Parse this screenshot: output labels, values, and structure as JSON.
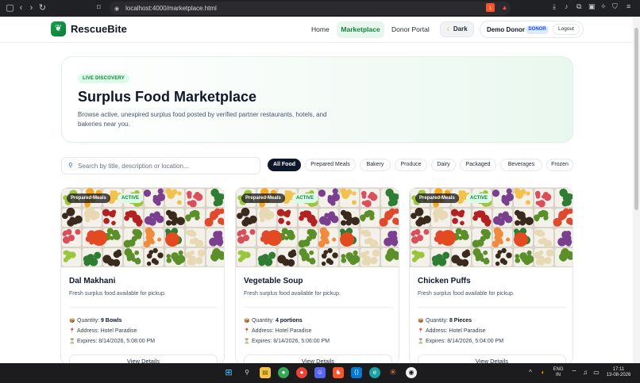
{
  "browser": {
    "url": "localhost:4000/marketplace.html",
    "brave_badge": "1"
  },
  "header": {
    "brand": "RescueBite",
    "nav": [
      "Home",
      "Marketplace",
      "Donor Portal"
    ],
    "theme_label": "Dark",
    "user_name": "Demo Donor",
    "role": "DONOR",
    "logout": "Logout"
  },
  "hero": {
    "badge": "LIVE DISCOVERY",
    "title": "Surplus Food Marketplace",
    "description": "Browse active, unexpired surplus food posted by verified partner restaurants, hotels, and bakeries near you."
  },
  "search": {
    "placeholder": "Search by title, description or location..."
  },
  "filters": [
    "All Food",
    "Prepared Meals",
    "Bakery",
    "Produce",
    "Dairy",
    "Packaged",
    "Beverages",
    "Frozen"
  ],
  "active_filter": "All Food",
  "cards": [
    {
      "category": "Prepared-Meals",
      "status": "ACTIVE",
      "title": "Dal Makhani",
      "description": "Fresh surplus food available for pickup.",
      "quantity_label": "Quantity:",
      "quantity": "9 Bowls",
      "address": "Address: Hotel Paradise",
      "expires": "Expires: 8/14/2026, 5:08:00 PM",
      "button": "View Details"
    },
    {
      "category": "Prepared-Meals",
      "status": "ACTIVE",
      "title": "Vegetable Soup",
      "description": "Fresh surplus food available for pickup.",
      "quantity_label": "Quantity:",
      "quantity": "4 portions",
      "address": "Address: Hotel Paradise",
      "expires": "Expires: 8/14/2026, 5:06:00 PM",
      "button": "View Details"
    },
    {
      "category": "Prepared-Meals",
      "status": "ACTIVE",
      "title": "Chicken Puffs",
      "description": "Fresh surplus food available for pickup.",
      "quantity_label": "Quantity:",
      "quantity": "8 Pieces",
      "address": "Address: Hotel Paradise",
      "expires": "Expires: 8/14/2026, 5:04:00 PM",
      "button": "View Details"
    }
  ],
  "taskbar": {
    "lang_line1": "ENG",
    "lang_line2": "IN",
    "time": "17:11",
    "date": "13-08-2026"
  },
  "colors": {
    "brand_green": "#16a34a",
    "active_chip": "#0f172a",
    "badge_green_bg": "#dcfce7",
    "role_blue": "#1d4ed8"
  }
}
